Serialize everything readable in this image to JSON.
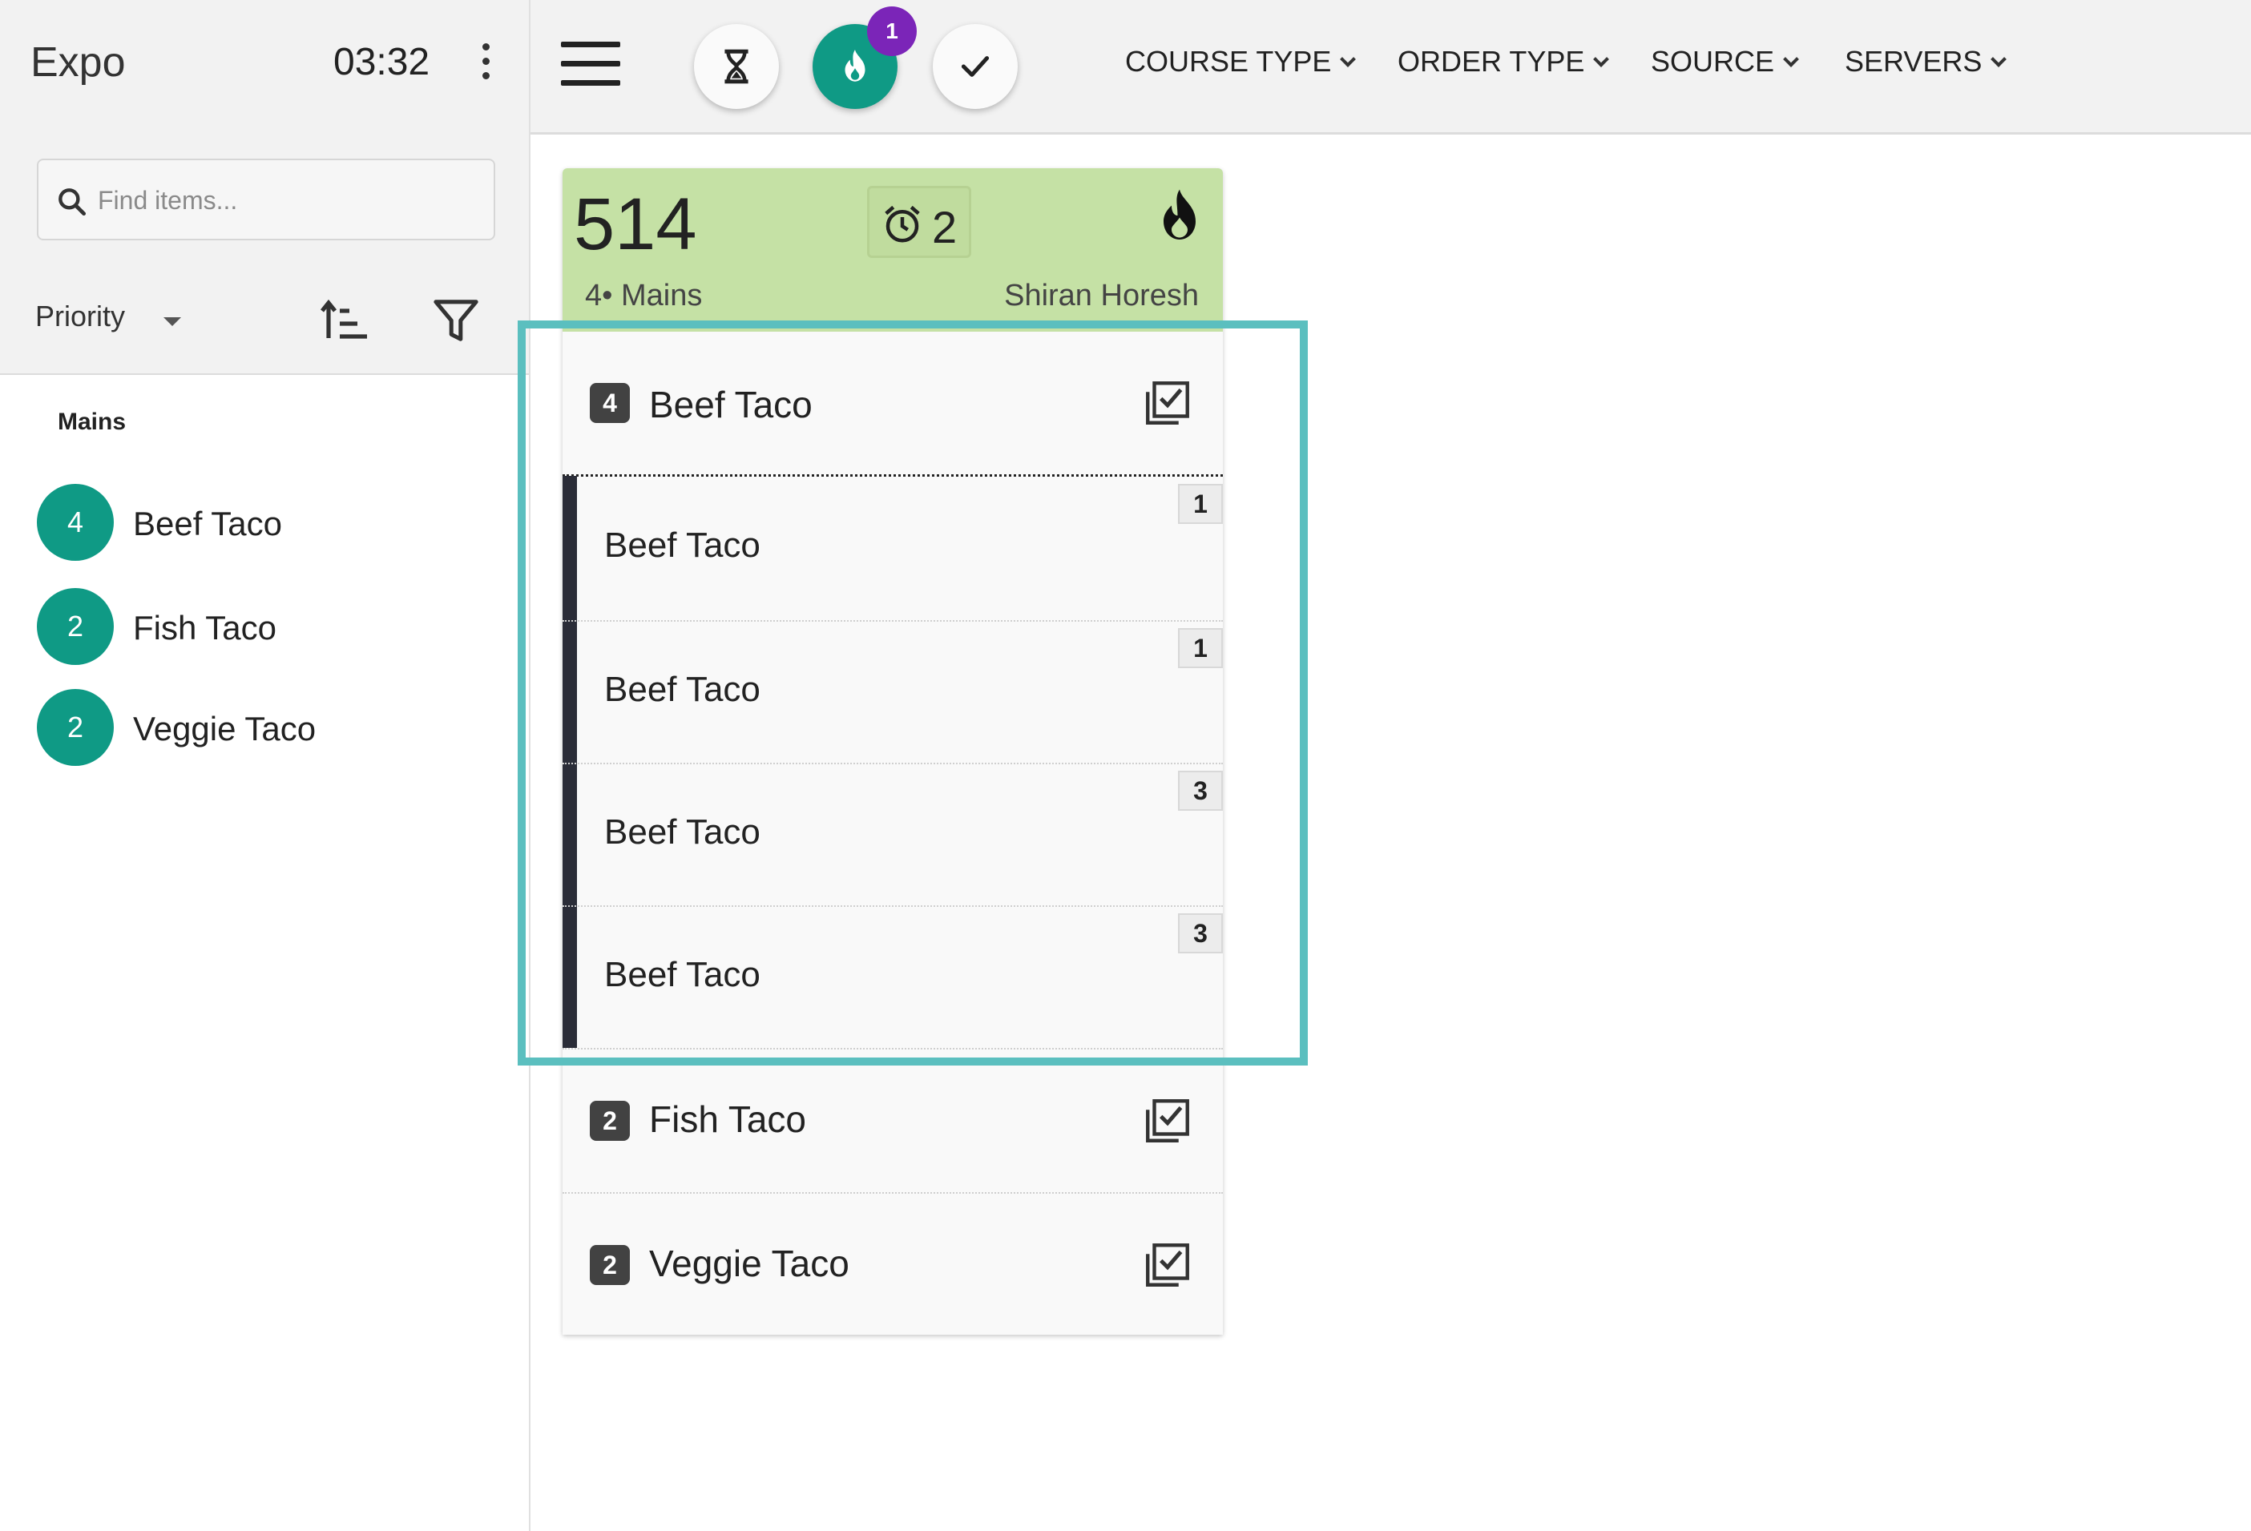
{
  "sidebar": {
    "title": "Expo",
    "clock": "03:32",
    "search_placeholder": "Find items...",
    "sort_label": "Priority",
    "group_label": "Mains",
    "items": [
      {
        "count": "4",
        "name": "Beef Taco"
      },
      {
        "count": "2",
        "name": "Fish Taco"
      },
      {
        "count": "2",
        "name": "Veggie Taco"
      }
    ]
  },
  "topbar": {
    "notification_count": "1",
    "filters": [
      "COURSE TYPE",
      "ORDER TYPE",
      "SOURCE",
      "SERVERS"
    ]
  },
  "ticket": {
    "number": "514",
    "timer_count": "2",
    "subtitle": "4• Mains",
    "server": "Shiran Horesh",
    "lines": [
      {
        "qty": "4",
        "name": "Beef Taco",
        "sub_items": [
          {
            "name": "Beef Taco",
            "seat": "1"
          },
          {
            "name": "Beef Taco",
            "seat": "1"
          },
          {
            "name": "Beef Taco",
            "seat": "3"
          },
          {
            "name": "Beef Taco",
            "seat": "3"
          }
        ]
      },
      {
        "qty": "2",
        "name": "Fish Taco"
      },
      {
        "qty": "2",
        "name": "Veggie Taco"
      }
    ]
  },
  "colors": {
    "accent": "#0f9a85",
    "ticket_header": "#c5e1a5",
    "badge": "#7b25b8",
    "highlight": "#5bbfbf"
  }
}
